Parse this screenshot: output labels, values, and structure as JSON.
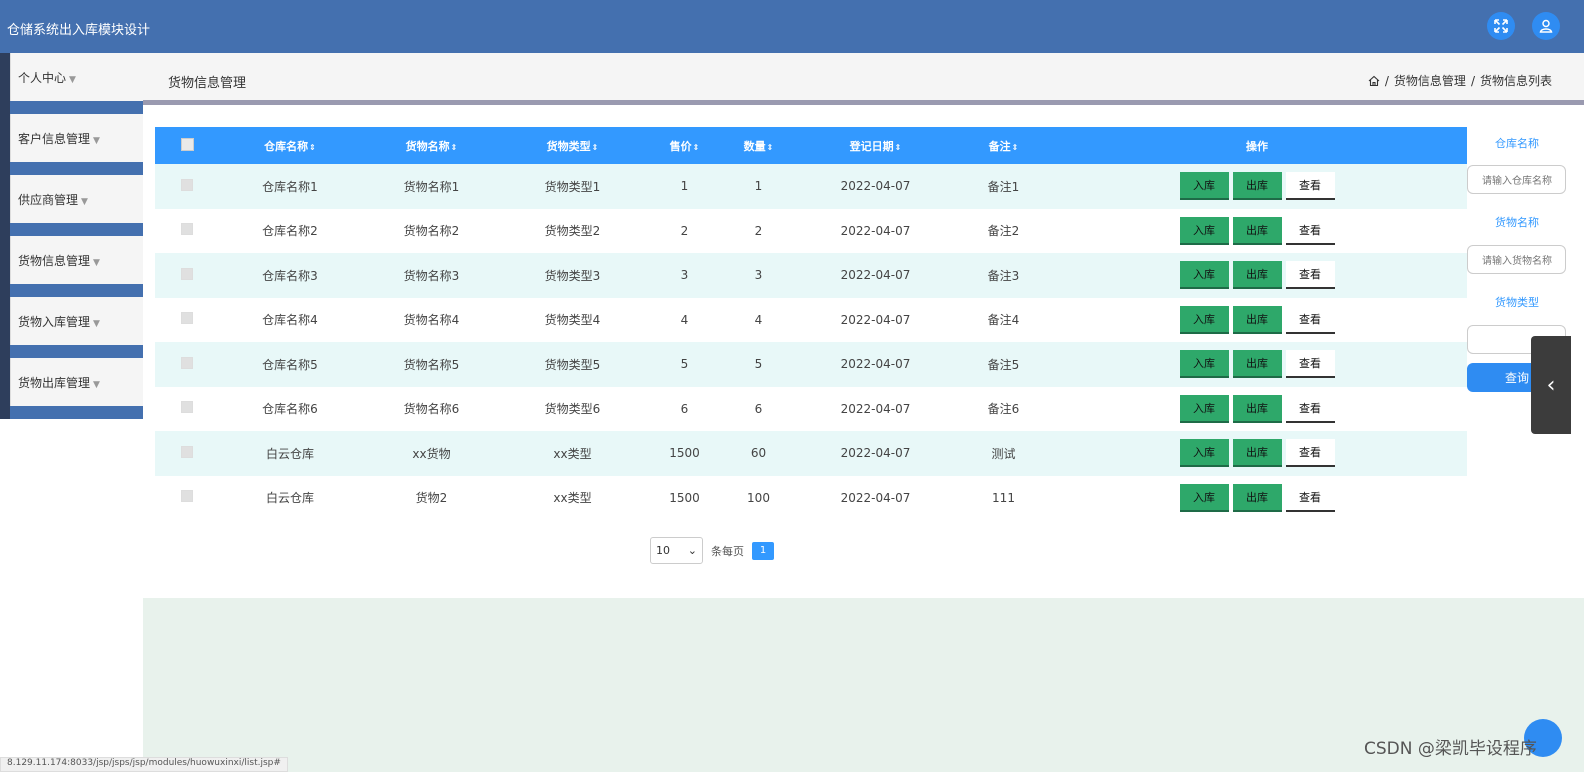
{
  "app": {
    "title": "仓储系统出入库模块设计"
  },
  "top_icons": {
    "fullscreen": "fullscreen-icon",
    "user": "user-icon"
  },
  "sidebar": {
    "items": [
      {
        "label": "个人中心"
      },
      {
        "label": "客户信息管理"
      },
      {
        "label": "供应商管理"
      },
      {
        "label": "货物信息管理"
      },
      {
        "label": "货物入库管理"
      },
      {
        "label": "货物出库管理"
      }
    ]
  },
  "header": {
    "title": "货物信息管理",
    "breadcrumb": [
      "货物信息管理",
      "货物信息列表"
    ],
    "separator": "/"
  },
  "table": {
    "columns": [
      "仓库名称",
      "货物名称",
      "货物类型",
      "售价",
      "数量",
      "登记日期",
      "备注",
      "操作"
    ],
    "actions": {
      "in": "入库",
      "out": "出库",
      "view": "查看"
    },
    "rows": [
      [
        "仓库名称1",
        "货物名称1",
        "货物类型1",
        "1",
        "1",
        "2022-04-07",
        "备注1"
      ],
      [
        "仓库名称2",
        "货物名称2",
        "货物类型2",
        "2",
        "2",
        "2022-04-07",
        "备注2"
      ],
      [
        "仓库名称3",
        "货物名称3",
        "货物类型3",
        "3",
        "3",
        "2022-04-07",
        "备注3"
      ],
      [
        "仓库名称4",
        "货物名称4",
        "货物类型4",
        "4",
        "4",
        "2022-04-07",
        "备注4"
      ],
      [
        "仓库名称5",
        "货物名称5",
        "货物类型5",
        "5",
        "5",
        "2022-04-07",
        "备注5"
      ],
      [
        "仓库名称6",
        "货物名称6",
        "货物类型6",
        "6",
        "6",
        "2022-04-07",
        "备注6"
      ],
      [
        "白云仓库",
        "xx货物",
        "xx类型",
        "1500",
        "60",
        "2022-04-07",
        "测试"
      ],
      [
        "白云仓库",
        "货物2",
        "xx类型",
        "1500",
        "100",
        "2022-04-07",
        "111"
      ]
    ]
  },
  "pagination": {
    "page_size": "10",
    "per_page_label": "条每页",
    "current_page": "1"
  },
  "search": {
    "warehouse_label": "仓库名称",
    "warehouse_placeholder": "请输入仓库名称",
    "goods_label": "货物名称",
    "goods_placeholder": "请输入货物名称",
    "type_label": "货物类型",
    "type_value": "",
    "query_label": "查询"
  },
  "status_bar": {
    "url": "8.129.11.174:8033/jsp/jsps/jsp/modules/huowuxinxi/list.jsp#"
  },
  "watermark": "CSDN @梁凯毕设程序",
  "colors": {
    "topbar": "#4470af",
    "table_header": "#3399ff",
    "action_green": "#2ea86a",
    "row_alt": "#e8f8f8"
  }
}
